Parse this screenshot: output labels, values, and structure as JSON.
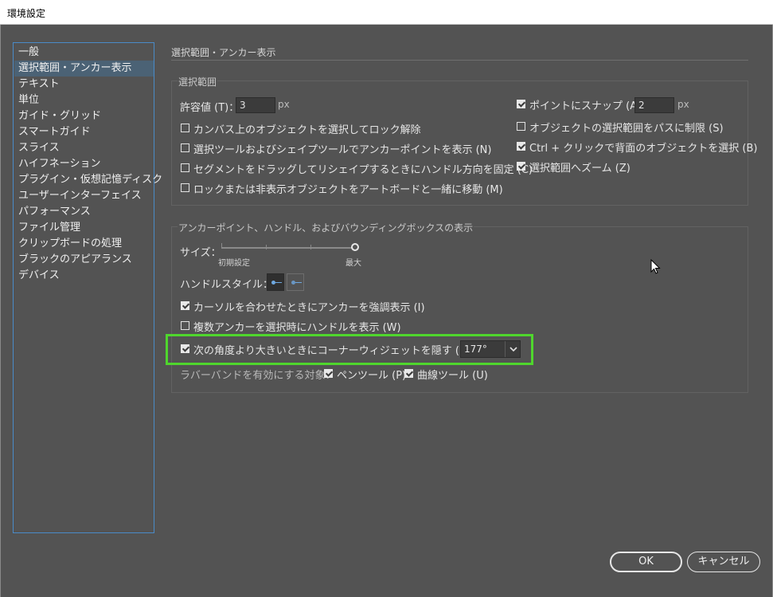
{
  "window": {
    "title": "環境設定"
  },
  "sidebar": {
    "items": [
      {
        "label": "一般"
      },
      {
        "label": "選択範囲・アンカー表示",
        "selected": true
      },
      {
        "label": "テキスト"
      },
      {
        "label": "単位"
      },
      {
        "label": "ガイド・グリッド"
      },
      {
        "label": "スマートガイド"
      },
      {
        "label": "スライス"
      },
      {
        "label": "ハイフネーション"
      },
      {
        "label": "プラグイン・仮想記憶ディスク"
      },
      {
        "label": "ユーザーインターフェイス"
      },
      {
        "label": "パフォーマンス"
      },
      {
        "label": "ファイル管理"
      },
      {
        "label": "クリップボードの処理"
      },
      {
        "label": "ブラックのアピアランス"
      },
      {
        "label": "デバイス"
      }
    ]
  },
  "section": {
    "heading": "選択範囲・アンカー表示"
  },
  "selection": {
    "title": "選択範囲",
    "tolerance": {
      "label": "許容値 (T)：",
      "value": "3",
      "unit": "px"
    },
    "options_left": [
      {
        "label": "カンバス上のオブジェクトを選択してロック解除",
        "checked": false
      },
      {
        "label": "選択ツールおよびシェイプツールでアンカーポイントを表示 (N)",
        "checked": false
      },
      {
        "label": "セグメントをドラッグしてリシェイプするときにハンドル方向を固定 (C)",
        "checked": false
      },
      {
        "label": "ロックまたは非表示オブジェクトをアートボードと一緒に移動 (M)",
        "checked": false
      }
    ],
    "snap": {
      "label": "ポイントにスナップ (A)",
      "checked": true,
      "value": "2",
      "unit": "px"
    },
    "options_right": [
      {
        "label": "オブジェクトの選択範囲をパスに制限 (S)",
        "checked": false
      },
      {
        "label": "Ctrl + クリックで背面のオブジェクトを選択 (B)",
        "checked": true
      },
      {
        "label": "選択範囲へズーム (Z)",
        "checked": true
      }
    ]
  },
  "anchor": {
    "title": "アンカーポイント、ハンドル、およびバウンディングボックスの表示",
    "size": {
      "label": "サイズ：",
      "min_label": "初期設定",
      "max_label": "最大",
      "level": 1.0
    },
    "handle_style": {
      "label": "ハンドルスタイル：",
      "selected": 0
    },
    "highlight_anchors": {
      "label": "カーソルを合わせたときにアンカーを強調表示 (I)",
      "checked": true
    },
    "show_handles": {
      "label": "複数アンカーを選択時にハンドルを表示 (W)",
      "checked": false
    },
    "hide_corner": {
      "label": "次の角度より大きいときにコーナーウィジェットを隠す (H)：",
      "checked": true,
      "value": "177°"
    },
    "rubber_band": {
      "label": "ラバーバンドを有効にする対象：",
      "pen": {
        "label": "ペンツール (P)",
        "checked": true
      },
      "curvature": {
        "label": "曲線ツール (U)",
        "checked": true
      }
    }
  },
  "buttons": {
    "ok": "OK",
    "cancel": "キャンセル"
  },
  "colors": {
    "background": "#535353",
    "selection": "#4b6275",
    "highlight": "#4fd62d",
    "sidebar_border": "#4a8bc8"
  }
}
